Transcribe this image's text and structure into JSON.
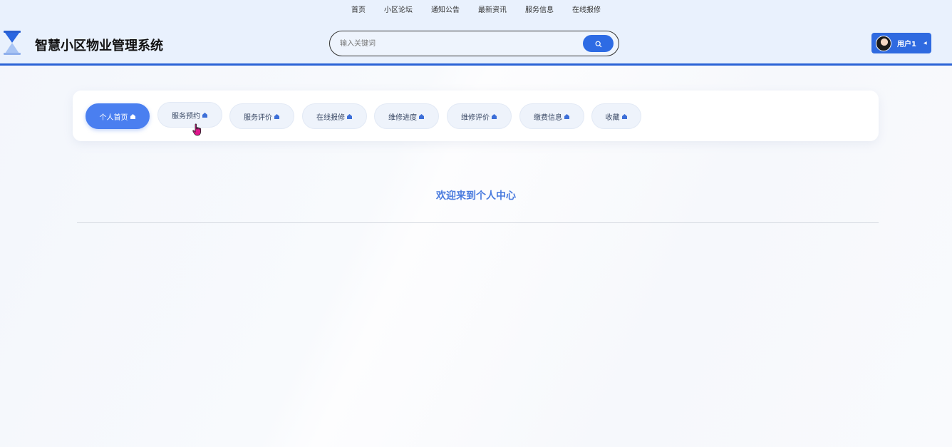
{
  "topnav": {
    "items": [
      {
        "label": "首页"
      },
      {
        "label": "小区论坛"
      },
      {
        "label": "通知公告"
      },
      {
        "label": "最新资讯"
      },
      {
        "label": "服务信息"
      },
      {
        "label": "在线报修"
      }
    ]
  },
  "header": {
    "title": "智慧小区物业管理系统",
    "logo_icon": "hourglass-icon",
    "accent_color": "#2b63d6"
  },
  "search": {
    "placeholder": "输入关键词",
    "value": "",
    "button_icon": "search-icon"
  },
  "user": {
    "name": "用户1",
    "avatar_icon": "avatar",
    "caret_icon": "caret-left-icon"
  },
  "tabs": [
    {
      "label": "个人首页",
      "active": true
    },
    {
      "label": "服务预约",
      "active": false
    },
    {
      "label": "服务评价",
      "active": false
    },
    {
      "label": "在线报修",
      "active": false
    },
    {
      "label": "维修进度",
      "active": false
    },
    {
      "label": "维修评价",
      "active": false
    },
    {
      "label": "缴费信息",
      "active": false
    },
    {
      "label": "收藏",
      "active": false
    }
  ],
  "main": {
    "welcome": "欢迎来到个人中心"
  },
  "colors": {
    "primary": "#2f6ae0",
    "active_tab": "#4a7ff0",
    "welcome_text": "#4a7bde"
  }
}
